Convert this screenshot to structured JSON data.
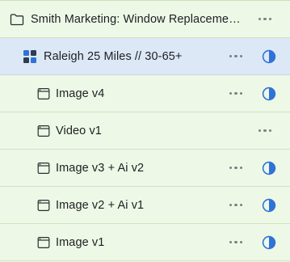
{
  "tree": {
    "folder": {
      "label": "Smith Marketing: Window Replacement...",
      "icon": "folder-icon",
      "menu_icon": "more-horizontal-icon"
    },
    "campaign": {
      "label": "Raleigh 25 Miles // 30-65+",
      "icon": "grid-blocks-icon",
      "menu_icon": "more-horizontal-icon",
      "status_icon": "half-circle-contrast-icon",
      "accent": "#2f73d9"
    },
    "items": [
      {
        "label": "Image v4",
        "icon": "window-icon",
        "has_status": true
      },
      {
        "label": "Video v1",
        "icon": "window-icon",
        "has_status": false
      },
      {
        "label": "Image v3 + Ai v2",
        "icon": "window-icon",
        "has_status": true
      },
      {
        "label": "Image v2 + Ai v1",
        "icon": "window-icon",
        "has_status": true
      },
      {
        "label": "Image v1",
        "icon": "window-icon",
        "has_status": true
      }
    ]
  },
  "colors": {
    "background": "#eef8e6",
    "selected_row": "#dde8f6",
    "status_blue": "#2f73d9",
    "icon_dark": "#2c3e50"
  }
}
